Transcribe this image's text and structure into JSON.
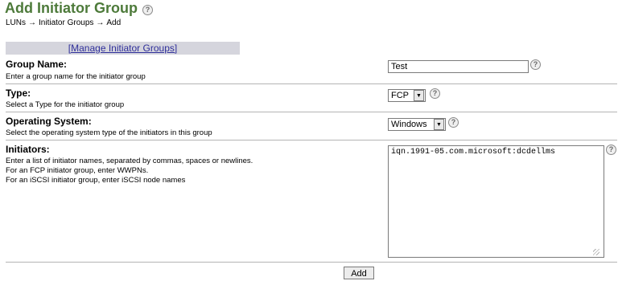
{
  "page": {
    "title": "Add Initiator Group",
    "help_glyph": "?"
  },
  "breadcrumb": {
    "items": [
      "LUNs",
      "Initiator Groups",
      "Add"
    ],
    "separator": "→"
  },
  "manage_link": "[Manage Initiator Groups]",
  "fields": {
    "group_name": {
      "label": "Group Name:",
      "description": "Enter a group name for the initiator group",
      "value": "Test"
    },
    "type": {
      "label": "Type:",
      "description": "Select a Type for the initiator group",
      "selected": "FCP"
    },
    "os": {
      "label": "Operating System:",
      "description": "Select the operating system type of the initiators in this group",
      "selected": "Windows"
    },
    "initiators": {
      "label": "Initiators:",
      "description_lines": [
        "Enter a list of initiator names, separated by commas, spaces or newlines.",
        "For an FCP initiator group, enter WWPNs.",
        "For an iSCSI initiator group, enter iSCSI node names"
      ],
      "value": "iqn.1991-05.com.microsoft:dcdellms"
    }
  },
  "submit_label": "Add",
  "colors": {
    "title": "#4d7a3a",
    "link": "#2e2e9a",
    "manage_bar_bg": "#d5d5dd",
    "separator": "#b4b4b4"
  },
  "icons": {
    "help": "help-icon",
    "dropdown": "chevron-down-icon"
  }
}
